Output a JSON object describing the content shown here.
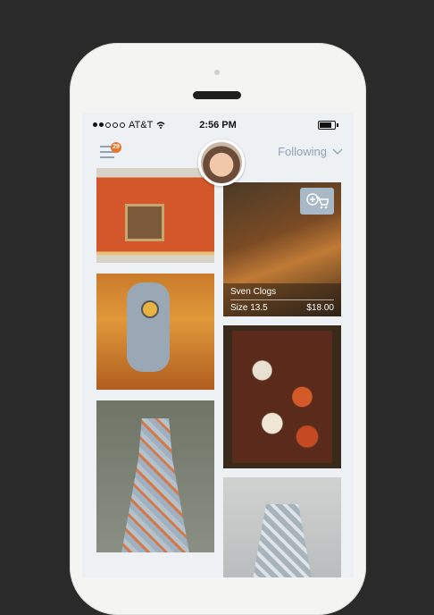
{
  "status_bar": {
    "carrier": "AT&T",
    "time": "2:56 PM",
    "battery_level": 0.8
  },
  "header": {
    "notification_count": "29",
    "filter_label": "Following"
  },
  "listing": {
    "title": "Sven Clogs",
    "size": "Size 13.5",
    "price": "$18.00"
  },
  "icons": [
    "menu-icon",
    "wifi-icon",
    "battery-icon",
    "chevron-down-icon",
    "add-to-cart-icon"
  ]
}
